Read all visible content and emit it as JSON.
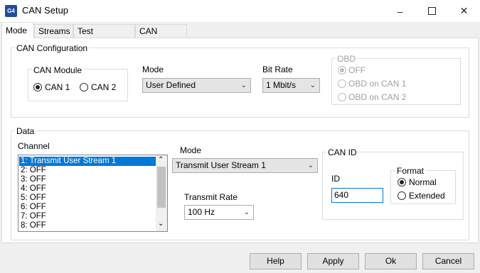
{
  "window": {
    "title": "CAN Setup",
    "app_icon": "app-logo-icon",
    "minimize_icon": "–",
    "maximize_icon": "☐",
    "close_icon": "✕"
  },
  "tabs": [
    {
      "label": "Mode",
      "active": true
    },
    {
      "label": "Streams",
      "active": false
    },
    {
      "label": "Test Calculator",
      "active": false
    },
    {
      "label": "CAN Devices",
      "active": false
    }
  ],
  "can_configuration": {
    "label": "CAN Configuration",
    "can_module": {
      "label": "CAN Module",
      "options": [
        "CAN 1",
        "CAN 2"
      ],
      "selected": "CAN 1"
    },
    "mode": {
      "label": "Mode",
      "value": "User Defined"
    },
    "bit_rate": {
      "label": "Bit Rate",
      "value": "1 Mbit/s"
    },
    "obd": {
      "label": "OBD",
      "options": [
        "OFF",
        "OBD on CAN 1",
        "OBD on CAN 2"
      ],
      "selected": "OFF",
      "enabled": false
    }
  },
  "data": {
    "label": "Data",
    "channel": {
      "label": "Channel",
      "items": [
        "1: Transmit User Stream 1",
        "2: OFF",
        "3: OFF",
        "4: OFF",
        "5: OFF",
        "6: OFF",
        "7: OFF",
        "8: OFF"
      ],
      "selected_index": 0
    },
    "mode": {
      "label": "Mode",
      "value": "Transmit User Stream 1"
    },
    "transmit_rate": {
      "label": "Transmit Rate",
      "value": "100 Hz"
    },
    "can_id": {
      "label": "CAN ID",
      "id_label": "ID",
      "id_value": "640",
      "format": {
        "label": "Format",
        "options": [
          "Normal",
          "Extended"
        ],
        "selected": "Normal"
      }
    }
  },
  "buttons": {
    "help": "Help",
    "apply": "Apply",
    "ok": "Ok",
    "cancel": "Cancel"
  },
  "colors": {
    "selection": "#0078d7",
    "dialog_bg": "#f0f0f0",
    "panel_bg": "#ffffff"
  }
}
